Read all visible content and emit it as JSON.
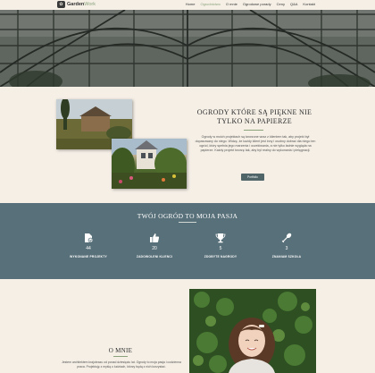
{
  "brand": {
    "name_main": "Garden",
    "name_accent": "Work",
    "logo_glyph": "✿"
  },
  "nav": {
    "items": [
      {
        "label": "Home",
        "active": false
      },
      {
        "label": "Ogrodnictwo",
        "active": true
      },
      {
        "label": "O mnie",
        "active": false
      },
      {
        "label": "Ogrodowe porady",
        "active": false
      },
      {
        "label": "Ceny",
        "active": false
      },
      {
        "label": "Q&A",
        "active": false
      },
      {
        "label": "Kontakt",
        "active": false
      }
    ]
  },
  "intro": {
    "title": "OGRODY KTÓRE SĄ PIĘKNE NIE TYLKO NA PAPIERZE",
    "text": "Ogrody w moich projektach są tworzone wraz z klientem tak, aby projekt był dopasowany do niego. Widzę, że każdy klient jest inny i osobny dobrać dla niego ten ogród, który spełnia jego marzenia i oczekiwania, a nie tylko ładnie wygląda na papierze. Każdy projekt tworzę tak, aby był realny do wykonania i pielęgnacji.",
    "button_label": "Portfolio"
  },
  "stats": {
    "title": "TWÓJ OGRÓD TO MOJA PASJA",
    "items": [
      {
        "icon": "document-check-icon",
        "number": "44",
        "label": "WYKONANE PROJEKTY"
      },
      {
        "icon": "thumbs-up-icon",
        "number": "20",
        "label": "ZADOWOLENI KLIENCI"
      },
      {
        "icon": "trophy-icon",
        "number": "5",
        "label": "ZDOBYTE NAGRODY"
      },
      {
        "icon": "shovel-icon",
        "number": "3",
        "label": "ZNANIAM SZKOŁA"
      }
    ]
  },
  "about": {
    "title": "O MNIE",
    "text": "Jestem architektem krajobrazu od ponad dziesięciu lat. Ogrody to moja pasja i codzienna praca. Projektuję z myślą o ludziach, którzy będą z nich korzystać."
  },
  "colors": {
    "accent": "#8aa37b",
    "band": "#587079",
    "background": "#f5efe6",
    "button": "#4f6568"
  }
}
